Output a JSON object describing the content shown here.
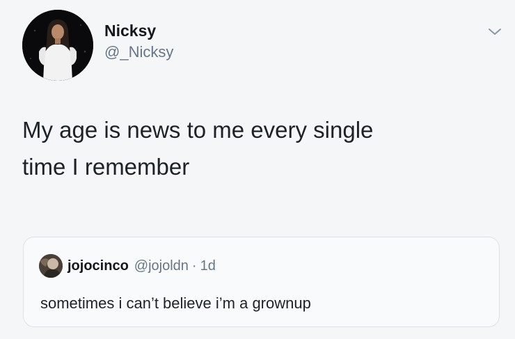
{
  "tweet": {
    "author": {
      "display_name": "Nicksy",
      "handle": "@_Nicksy",
      "avatar_icon": "profile-photo-woman-in-white-dress"
    },
    "menu_icon": "chevron-down-icon",
    "text": "My age is news to me every single\ntime I remember"
  },
  "quote_tweet": {
    "author": {
      "display_name": "jojocinco",
      "handle": "@jojoldn",
      "separator": "·",
      "time": "1d",
      "avatar_icon": "profile-photo"
    },
    "text": "sometimes i can’t believe i’m a grownup"
  },
  "colors": {
    "background": "#f5f6f8",
    "text": "#14171a",
    "secondary_text": "#657786",
    "quote_border": "#dde2e7"
  }
}
